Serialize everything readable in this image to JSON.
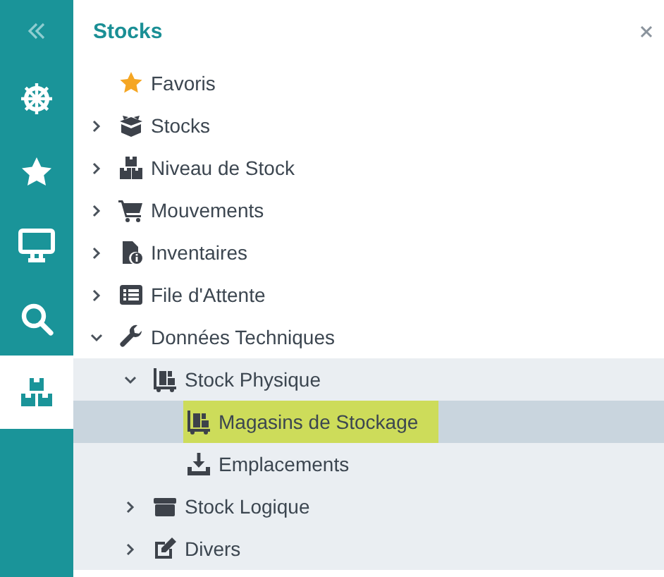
{
  "rail": {
    "items": [
      {
        "selected": false
      },
      {
        "selected": false
      },
      {
        "selected": false
      },
      {
        "selected": false
      },
      {
        "selected": true
      }
    ]
  },
  "panel": {
    "title": "Stocks"
  },
  "tree": [
    {
      "label": "Favoris",
      "selected": false,
      "highlighted": false
    },
    {
      "label": "Stocks",
      "expanded": false,
      "selected": false,
      "highlighted": false
    },
    {
      "label": "Niveau de Stock",
      "expanded": false,
      "selected": false,
      "highlighted": false
    },
    {
      "label": "Mouvements",
      "expanded": false,
      "selected": false,
      "highlighted": false
    },
    {
      "label": "Inventaires",
      "expanded": false,
      "selected": false,
      "highlighted": false
    },
    {
      "label": "File d'Attente",
      "expanded": false,
      "selected": false,
      "highlighted": false
    },
    {
      "label": "Données Techniques",
      "expanded": true,
      "selected": false,
      "highlighted": false,
      "children": [
        {
          "label": "Stock Physique",
          "expanded": true,
          "selected": false,
          "highlighted": false,
          "children": [
            {
              "label": "Magasins de Stockage",
              "selected": true,
              "highlighted": true
            },
            {
              "label": "Emplacements",
              "selected": false,
              "highlighted": false
            }
          ]
        },
        {
          "label": "Stock Logique",
          "expanded": false,
          "selected": false,
          "highlighted": false
        },
        {
          "label": "Divers",
          "expanded": false,
          "selected": false,
          "highlighted": false
        }
      ]
    }
  ]
}
